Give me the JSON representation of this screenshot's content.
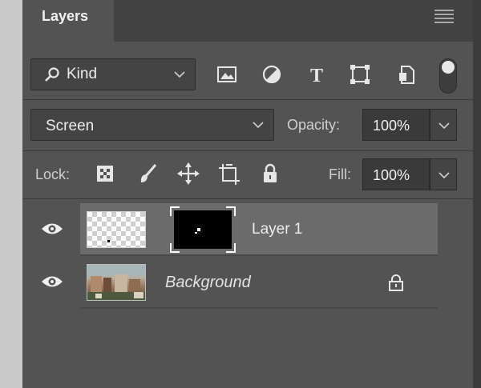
{
  "panel": {
    "tab_title": "Layers",
    "menu_icon": "hamburger-menu-icon"
  },
  "filter": {
    "kind_label": "Kind",
    "icons": [
      "search-icon",
      "image-filter-icon",
      "adjustment-filter-icon",
      "type-filter-icon",
      "shape-filter-icon",
      "smart-object-filter-icon"
    ]
  },
  "blend": {
    "mode": "Screen",
    "opacity_label": "Opacity:",
    "opacity_value": "100%"
  },
  "lock": {
    "label": "Lock:",
    "icons": [
      "lock-transparent-pixels-icon",
      "lock-image-pixels-icon",
      "lock-position-icon",
      "lock-artboard-icon",
      "lock-all-icon"
    ],
    "fill_label": "Fill:",
    "fill_value": "100%"
  },
  "layers": [
    {
      "name": "Layer 1",
      "visible": true,
      "selected": true,
      "has_mask": true
    },
    {
      "name": "Background",
      "visible": true,
      "selected": false,
      "locked": true
    }
  ],
  "colors": {
    "panel_bg": "#535353",
    "tab_bar_bg": "#424242",
    "selected_row": "#6b6b6b",
    "field_bg": "#3a3a3a"
  }
}
